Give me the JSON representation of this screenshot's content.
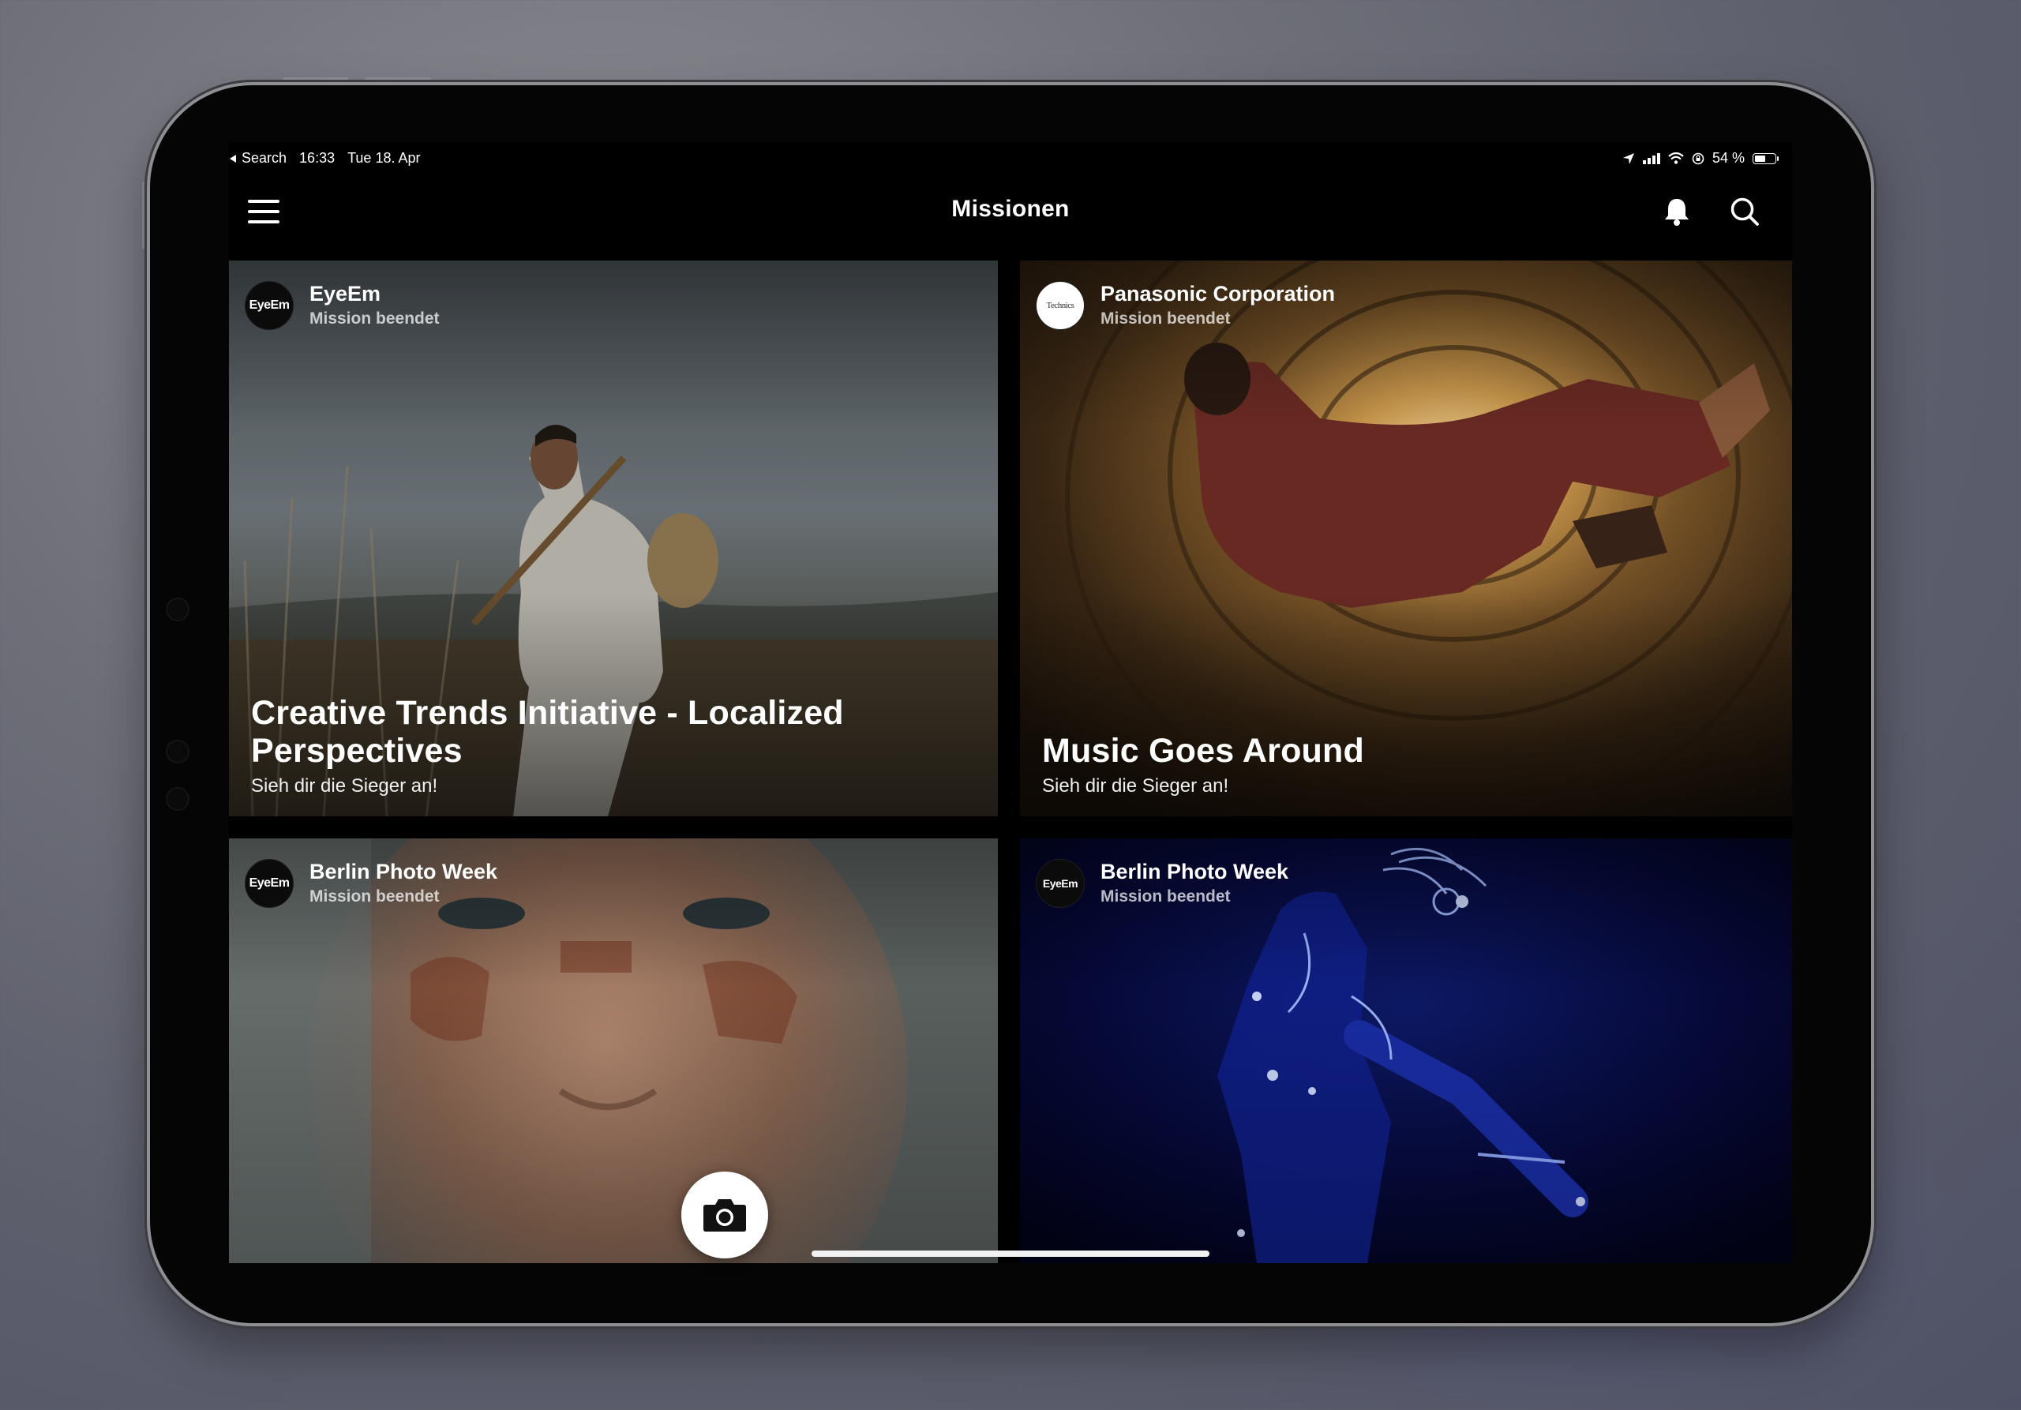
{
  "status_bar": {
    "back_app": "Search",
    "time": "16:33",
    "date": "Tue 18. Apr",
    "battery": "54 %",
    "battery_level": 0.54
  },
  "nav": {
    "title": "Missionen",
    "icons": [
      "menu-icon",
      "bell-icon",
      "search-icon"
    ]
  },
  "missions": [
    {
      "sponsor": "EyeEm",
      "avatar_text": "EyeEm",
      "status": "Mission beendet",
      "title": "Creative Trends Initiative - Localized Perspectives",
      "subtitle": "Sieh dir die Sieger an!"
    },
    {
      "sponsor": "Panasonic Corporation",
      "avatar_text": "Technics",
      "status": "Mission beendet",
      "title": "Music Goes Around",
      "subtitle": "Sieh dir die Sieger an!"
    },
    {
      "sponsor": "Berlin Photo Week",
      "avatar_text": "EyeEm",
      "status": "Mission beendet"
    },
    {
      "sponsor": "Berlin Photo Week",
      "avatar_text": "EyeEm",
      "status": "Mission beendet"
    }
  ],
  "fab": {
    "icon": "camera-icon"
  }
}
